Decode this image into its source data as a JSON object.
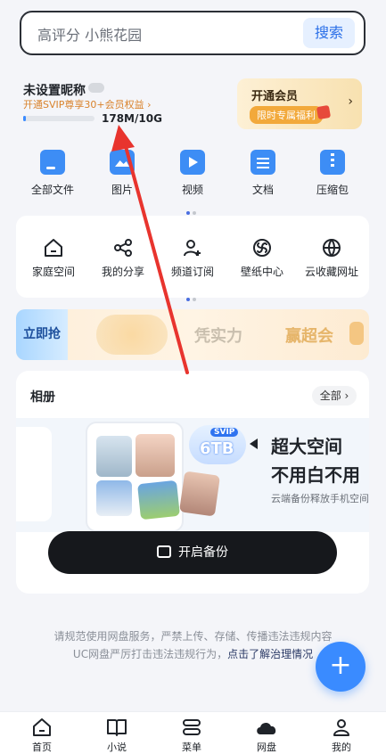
{
  "search": {
    "placeholder": "高评分 小熊花园",
    "button": "搜索"
  },
  "account": {
    "nickname": "未设置昵称",
    "svip_promo": "开通SVIP尊享30+会员权益 ›",
    "storage_used_fraction": 0.02,
    "quota": "178M/10G"
  },
  "vip_card": {
    "title": "开通会员",
    "tag": "限时专属福利",
    "arrow": "›"
  },
  "categories": [
    {
      "label": "全部文件",
      "icon": "folder-icon"
    },
    {
      "label": "图片",
      "icon": "image-icon"
    },
    {
      "label": "视频",
      "icon": "video-icon"
    },
    {
      "label": "文档",
      "icon": "document-icon"
    },
    {
      "label": "压缩包",
      "icon": "zip-icon"
    }
  ],
  "tools": [
    {
      "label": "家庭空间",
      "icon": "home-icon"
    },
    {
      "label": "我的分享",
      "icon": "share-icon"
    },
    {
      "label": "频道订阅",
      "icon": "user-add-icon"
    },
    {
      "label": "壁纸中心",
      "icon": "pinwheel-icon"
    },
    {
      "label": "云收藏网址",
      "icon": "globe-icon"
    }
  ],
  "banner": {
    "button": "立即抢",
    "slogan_1": "凭实力",
    "slogan_2": "赢超会"
  },
  "album": {
    "title": "相册",
    "all": "全部 ›",
    "svip_badge": "SVIP",
    "capacity": "6TB",
    "headline_1": "超大空间",
    "headline_2": "不用白不用",
    "subline": "云端备份释放手机空间",
    "backup_button": "开启备份"
  },
  "notice": {
    "line_1": "请规范使用网盘服务，严禁上传、存储、传播违法违规内容",
    "line_2_prefix": "UC网盘严厉打击违法违规行为，",
    "line_2_link": "点击了解治理情况"
  },
  "fab": {
    "label": "+"
  },
  "tabbar": [
    {
      "label": "首页",
      "icon": "home-icon"
    },
    {
      "label": "小说",
      "icon": "book-icon"
    },
    {
      "label": "菜单",
      "icon": "menu-icon"
    },
    {
      "label": "网盘",
      "icon": "cloud-icon",
      "active": true
    },
    {
      "label": "我的",
      "icon": "profile-icon"
    }
  ],
  "colors": {
    "accent": "#3a8bff",
    "annotation_arrow": "#e8342e",
    "vip_gold": "#f2a93b"
  }
}
